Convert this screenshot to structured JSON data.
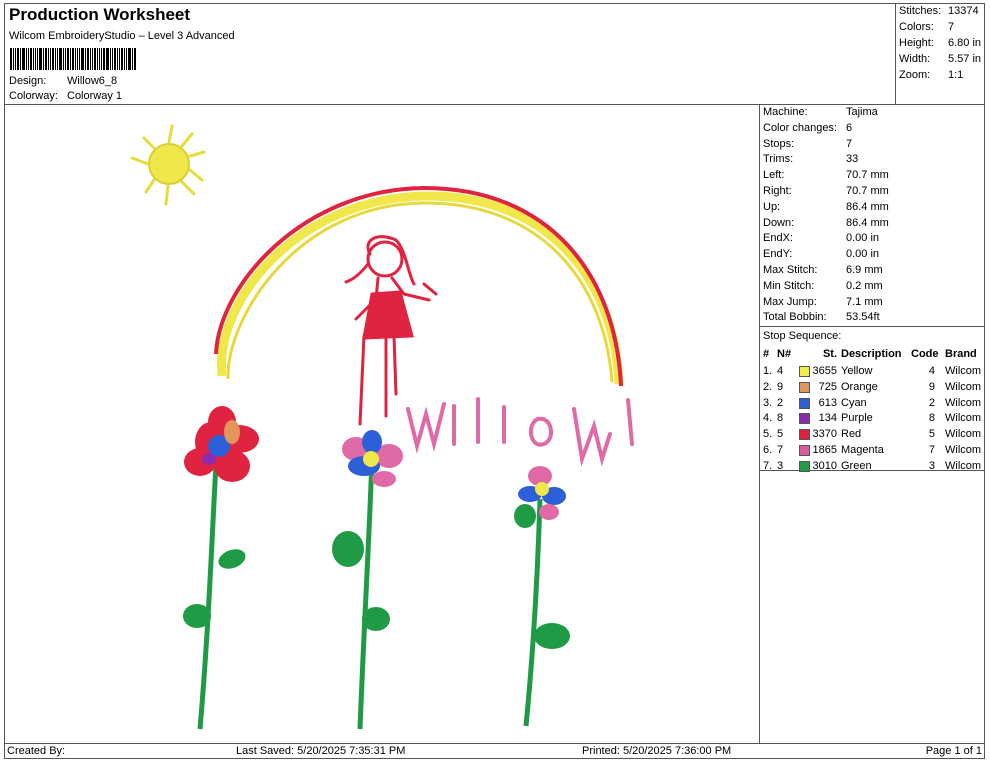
{
  "header": {
    "title": "Production Worksheet",
    "software": "Wilcom EmbroideryStudio – Level 3 Advanced",
    "design_label": "Design:",
    "design_value": "Willow6_8",
    "colorway_label": "Colorway:",
    "colorway_value": "Colorway 1"
  },
  "stats": [
    {
      "label": "Stitches:",
      "value": "13374"
    },
    {
      "label": "Colors:",
      "value": "7"
    },
    {
      "label": "Height:",
      "value": "6.80 in"
    },
    {
      "label": "Width:",
      "value": "5.57 in"
    },
    {
      "label": "Zoom:",
      "value": "1:1"
    }
  ],
  "machine_info": [
    {
      "label": "Machine:",
      "value": "Tajima"
    },
    {
      "label": "Color changes:",
      "value": "6"
    },
    {
      "label": "Stops:",
      "value": "7"
    },
    {
      "label": "Trims:",
      "value": "33"
    },
    {
      "label": "Left:",
      "value": "70.7 mm"
    },
    {
      "label": "Right:",
      "value": "70.7 mm"
    },
    {
      "label": "Up:",
      "value": "86.4 mm"
    },
    {
      "label": "Down:",
      "value": "86.4 mm"
    },
    {
      "label": "EndX:",
      "value": "0.00 in"
    },
    {
      "label": "EndY:",
      "value": "0.00 in"
    },
    {
      "label": "Max Stitch:",
      "value": "6.9 mm"
    },
    {
      "label": "Min Stitch:",
      "value": "0.2 mm"
    },
    {
      "label": "Max Jump:",
      "value": "7.1 mm"
    },
    {
      "label": "Total Bobbin:",
      "value": "53.54ft"
    }
  ],
  "stop_sequence": {
    "title": "Stop Sequence:",
    "headers": {
      "num": "#",
      "n": "N#",
      "st": "St.",
      "desc": "Description",
      "code": "Code",
      "brand": "Brand"
    },
    "rows": [
      {
        "num": "1.",
        "n": "4",
        "color": "#f2ec4b",
        "st": "3655",
        "desc": "Yellow",
        "code": "4",
        "brand": "Wilcom"
      },
      {
        "num": "2.",
        "n": "9",
        "color": "#e2965a",
        "st": "725",
        "desc": "Orange",
        "code": "9",
        "brand": "Wilcom"
      },
      {
        "num": "3.",
        "n": "2",
        "color": "#2c5fd8",
        "st": "613",
        "desc": "Cyan",
        "code": "2",
        "brand": "Wilcom"
      },
      {
        "num": "4.",
        "n": "8",
        "color": "#8a2bb0",
        "st": "134",
        "desc": "Purple",
        "code": "8",
        "brand": "Wilcom"
      },
      {
        "num": "5.",
        "n": "5",
        "color": "#e0203c",
        "st": "3370",
        "desc": "Red",
        "code": "5",
        "brand": "Wilcom"
      },
      {
        "num": "6.",
        "n": "7",
        "color": "#de5a9c",
        "st": "1865",
        "desc": "Magenta",
        "code": "7",
        "brand": "Wilcom"
      },
      {
        "num": "7.",
        "n": "3",
        "color": "#1f9a45",
        "st": "3010",
        "desc": "Green",
        "code": "3",
        "brand": "Wilcom"
      }
    ]
  },
  "footer": {
    "created_by": "Created By:",
    "last_saved": "Last Saved: 5/20/2025 7:35:31 PM",
    "printed": "Printed: 5/20/2025 7:36:00 PM",
    "page": "Page 1 of 1"
  },
  "design_preview": {
    "text": "WIIlOW",
    "colors": {
      "yellow": "#f0e84a",
      "red": "#df2340",
      "pink": "#e06aa8",
      "green": "#1f9a45",
      "blue": "#2c5fd8"
    }
  }
}
